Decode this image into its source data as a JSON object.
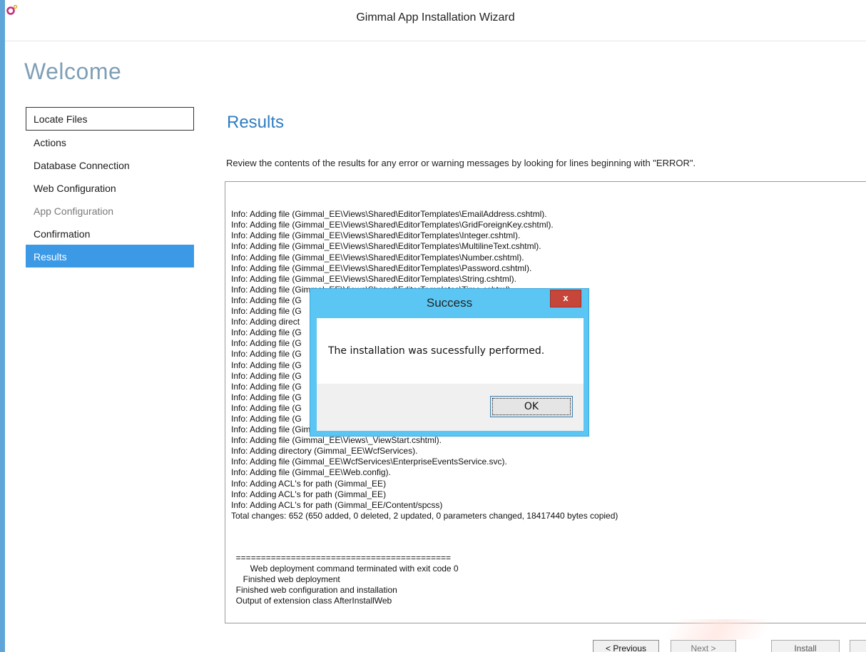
{
  "window": {
    "title": "Gimmal App Installation Wizard",
    "icon": "gimmal-logo-icon",
    "accent_color": "#5fa5d8"
  },
  "header": {
    "welcome": "Welcome"
  },
  "sidebar": {
    "items": [
      {
        "label": "Locate Files",
        "state": "focused"
      },
      {
        "label": "Actions",
        "state": "normal"
      },
      {
        "label": "Database Connection",
        "state": "normal"
      },
      {
        "label": "Web Configuration",
        "state": "normal"
      },
      {
        "label": "App Configuration",
        "state": "disabled"
      },
      {
        "label": "Confirmation",
        "state": "normal"
      },
      {
        "label": "Results",
        "state": "selected"
      }
    ],
    "selected_color": "#3c99e6"
  },
  "main": {
    "title": "Results",
    "description": "Review the contents of the results for any error or warning messages by looking for lines beginning with \"ERROR\".",
    "log_lines": [
      "Info: Adding file (Gimmal_EE\\Views\\Shared\\EditorTemplates\\EmailAddress.cshtml).",
      "Info: Adding file (Gimmal_EE\\Views\\Shared\\EditorTemplates\\GridForeignKey.cshtml).",
      "Info: Adding file (Gimmal_EE\\Views\\Shared\\EditorTemplates\\Integer.cshtml).",
      "Info: Adding file (Gimmal_EE\\Views\\Shared\\EditorTemplates\\MultilineText.cshtml).",
      "Info: Adding file (Gimmal_EE\\Views\\Shared\\EditorTemplates\\Number.cshtml).",
      "Info: Adding file (Gimmal_EE\\Views\\Shared\\EditorTemplates\\Password.cshtml).",
      "Info: Adding file (Gimmal_EE\\Views\\Shared\\EditorTemplates\\String.cshtml).",
      "Info: Adding file (Gimmal_EE\\Views\\Shared\\EditorTemplates\\Time.cshtml).",
      "Info: Adding file (G",
      "Info: Adding file (G",
      "Info: Adding direct",
      "Info: Adding file (G                                                                      .cshtml).",
      "Info: Adding file (G                                                                      ml).",
      "Info: Adding file (G",
      "Info: Adding file (G",
      "Info: Adding file (G",
      "Info: Adding file (G",
      "Info: Adding file (G",
      "Info: Adding file (G",
      "Info: Adding file (G",
      "Info: Adding file (Gimmal_EE\\Views\\Web.config).",
      "Info: Adding file (Gimmal_EE\\Views\\_ViewStart.cshtml).",
      "Info: Adding directory (Gimmal_EE\\WcfServices).",
      "Info: Adding file (Gimmal_EE\\WcfServices\\EnterpriseEventsService.svc).",
      "Info: Adding file (Gimmal_EE\\Web.config).",
      "Info: Adding ACL's for path (Gimmal_EE)",
      "Info: Adding ACL's for path (Gimmal_EE)",
      "Info: Adding ACL's for path (Gimmal_EE/Content/spcss)",
      "Total changes: 652 (650 added, 0 deleted, 2 updated, 0 parameters changed, 18417440 bytes copied)"
    ],
    "log_tail": [
      "  ===========================================",
      "        Web deployment command terminated with exit code 0",
      "     Finished web deployment",
      "  Finished web configuration and installation",
      "  Output of extension class AfterInstallWeb"
    ]
  },
  "footer": {
    "previous_label": "< Previous",
    "next_label": "Next >",
    "install_label": "Install"
  },
  "dialog": {
    "title": "Success",
    "message": "The installation was sucessfully performed.",
    "ok_label": "OK",
    "close_label": "x",
    "close_icon": "close-icon",
    "frame_color": "#5bc6f3",
    "close_color": "#c7463a"
  }
}
